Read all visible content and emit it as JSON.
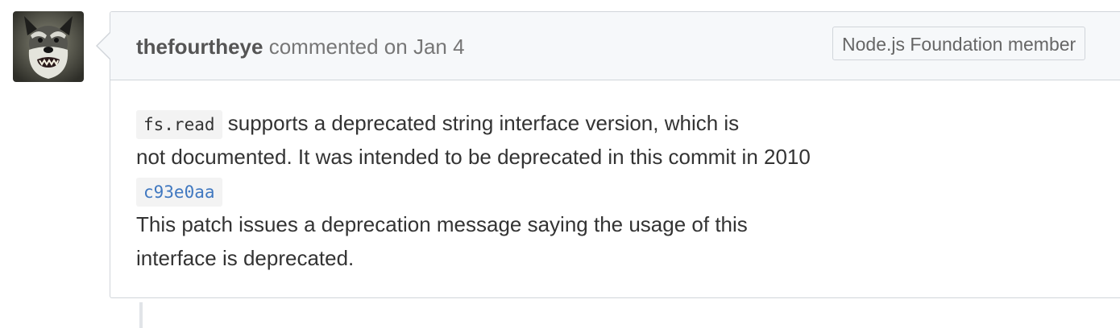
{
  "avatar": {
    "alt": "thefourtheye avatar"
  },
  "comment": {
    "author": "thefourtheye",
    "action": "commented",
    "on": "on",
    "date": "Jan 4",
    "badge": "Node.js Foundation member",
    "body": {
      "code_inline": "fs.read",
      "line1_rest": "supports a deprecated string interface version, which is",
      "line2": "not documented. It was intended to be deprecated in this commit in 2010",
      "commit_sha": "c93e0aa",
      "line4": "This patch issues a deprecation message saying the usage of this",
      "line5": "interface is deprecated."
    }
  },
  "colors": {
    "link": "#4078c0",
    "border": "#d1d5da",
    "header_bg": "#f6f8fa"
  }
}
